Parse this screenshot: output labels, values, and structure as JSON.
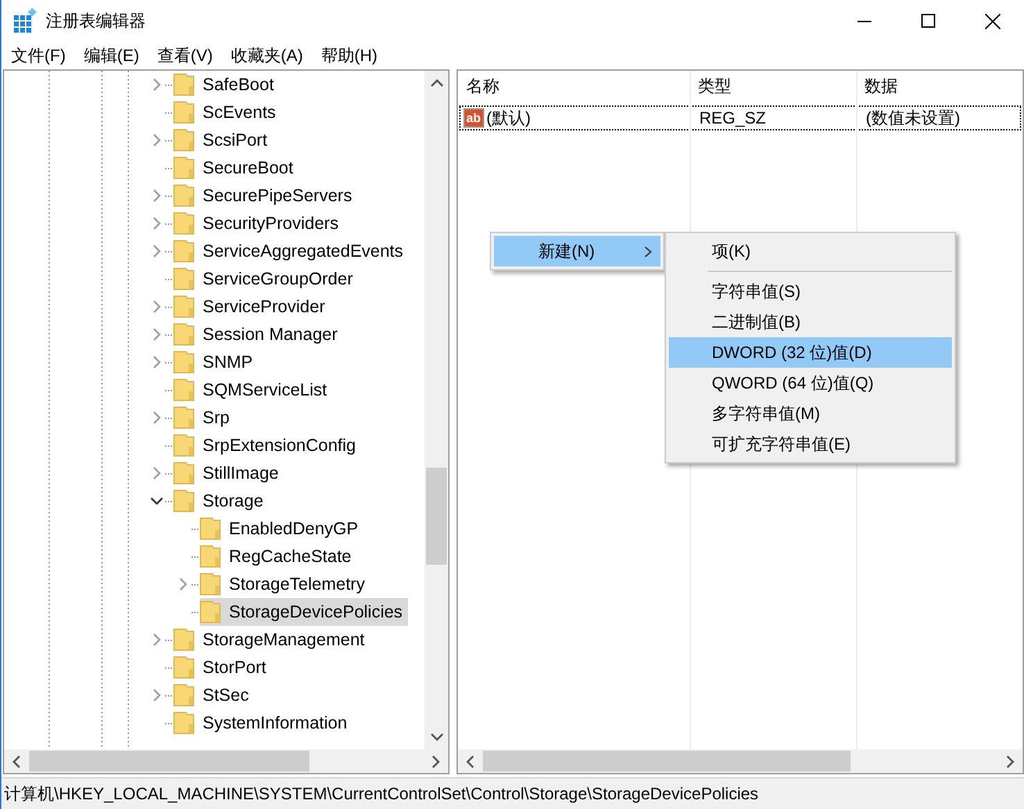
{
  "window": {
    "title": "注册表编辑器"
  },
  "menu": [
    "文件(F)",
    "编辑(E)",
    "查看(V)",
    "收藏夹(A)",
    "帮助(H)"
  ],
  "tree": {
    "items": [
      {
        "label": "SafeBoot",
        "expandable": true,
        "expanded": false,
        "selected": false
      },
      {
        "label": "ScEvents",
        "expandable": false,
        "selected": false
      },
      {
        "label": "ScsiPort",
        "expandable": true,
        "expanded": false,
        "selected": false
      },
      {
        "label": "SecureBoot",
        "expandable": false,
        "selected": false
      },
      {
        "label": "SecurePipeServers",
        "expandable": true,
        "expanded": false,
        "selected": false
      },
      {
        "label": "SecurityProviders",
        "expandable": true,
        "expanded": false,
        "selected": false
      },
      {
        "label": "ServiceAggregatedEvents",
        "expandable": true,
        "expanded": false,
        "selected": false
      },
      {
        "label": "ServiceGroupOrder",
        "expandable": false,
        "selected": false
      },
      {
        "label": "ServiceProvider",
        "expandable": true,
        "expanded": false,
        "selected": false
      },
      {
        "label": "Session Manager",
        "expandable": true,
        "expanded": false,
        "selected": false
      },
      {
        "label": "SNMP",
        "expandable": true,
        "expanded": false,
        "selected": false
      },
      {
        "label": "SQMServiceList",
        "expandable": false,
        "selected": false
      },
      {
        "label": "Srp",
        "expandable": true,
        "expanded": false,
        "selected": false
      },
      {
        "label": "SrpExtensionConfig",
        "expandable": false,
        "selected": false
      },
      {
        "label": "StillImage",
        "expandable": true,
        "expanded": false,
        "selected": false
      },
      {
        "label": "Storage",
        "expandable": true,
        "expanded": true,
        "selected": false,
        "children": [
          {
            "label": "EnabledDenyGP",
            "expandable": false,
            "selected": false
          },
          {
            "label": "RegCacheState",
            "expandable": false,
            "selected": false
          },
          {
            "label": "StorageTelemetry",
            "expandable": true,
            "expanded": false,
            "selected": false
          },
          {
            "label": "StorageDevicePolicies",
            "expandable": false,
            "selected": true
          }
        ]
      },
      {
        "label": "StorageManagement",
        "expandable": true,
        "expanded": false,
        "selected": false
      },
      {
        "label": "StorPort",
        "expandable": false,
        "selected": false
      },
      {
        "label": "StSec",
        "expandable": true,
        "expanded": false,
        "selected": false
      },
      {
        "label": "SystemInformation",
        "expandable": false,
        "selected": false
      }
    ]
  },
  "values": {
    "columns": [
      "名称",
      "类型",
      "数据"
    ],
    "rows": [
      {
        "icon_text": "ab",
        "name": "(默认)",
        "type": "REG_SZ",
        "data": "(数值未设置)",
        "focused": true
      }
    ]
  },
  "context_menu": {
    "items": [
      {
        "label": "新建(N)",
        "has_submenu": true,
        "selected": true
      }
    ]
  },
  "submenu": {
    "items": [
      {
        "kind": "item",
        "label": "项(K)",
        "selected": false
      },
      {
        "kind": "separator"
      },
      {
        "kind": "item",
        "label": "字符串值(S)",
        "selected": false
      },
      {
        "kind": "item",
        "label": "二进制值(B)",
        "selected": false
      },
      {
        "kind": "item",
        "label": "DWORD (32 位)值(D)",
        "selected": true
      },
      {
        "kind": "item",
        "label": "QWORD (64 位)值(Q)",
        "selected": false
      },
      {
        "kind": "item",
        "label": "多字符串值(M)",
        "selected": false
      },
      {
        "kind": "item",
        "label": "可扩充字符串值(E)",
        "selected": false
      }
    ]
  },
  "status_bar": "计算机\\HKEY_LOCAL_MACHINE\\SYSTEM\\CurrentControlSet\\Control\\Storage\\StorageDevicePolicies"
}
